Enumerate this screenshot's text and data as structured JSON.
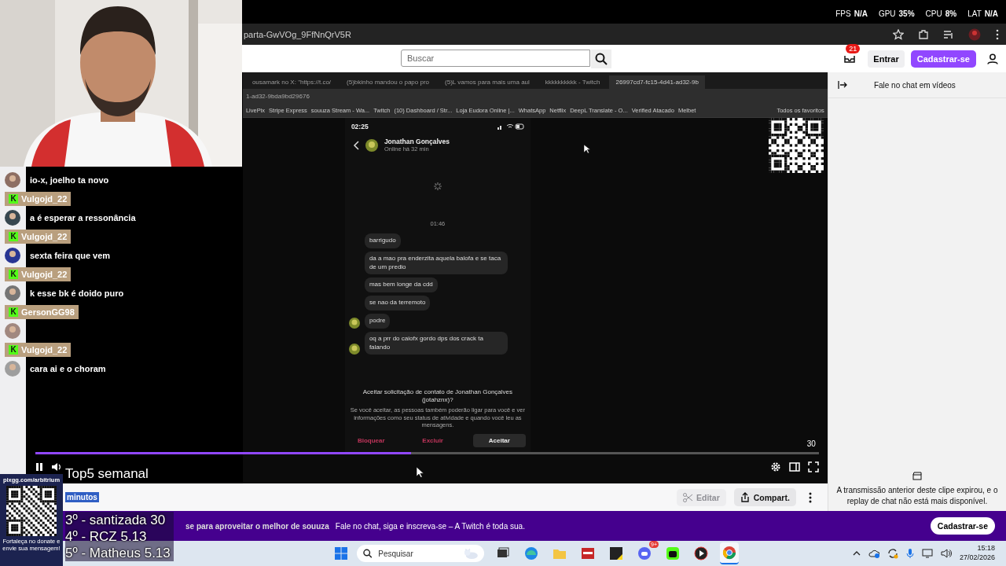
{
  "stats": [
    {
      "label": "FPS",
      "value": "N/A"
    },
    {
      "label": "GPU",
      "value": "35%"
    },
    {
      "label": "CPU",
      "value": "8%"
    },
    {
      "label": "LAT",
      "value": "N/A"
    }
  ],
  "browser": {
    "url": "parta-GwVOg_9FfNnQrV5R"
  },
  "header": {
    "search": {
      "placeholder": "Buscar"
    },
    "notifications": "21",
    "login": "Entrar",
    "signup": "Cadastrar-se"
  },
  "video": {
    "inner_browser": {
      "tabs": [
        {
          "title": "ousamark no X: \"https://t.co/",
          "selected": false
        },
        {
          "title": "(5)bkinho mandou o papo pro",
          "selected": false
        },
        {
          "title": "(5)L vamos para mais uma aul",
          "selected": false
        },
        {
          "title": "kkkkkkkkkk - Twitch",
          "selected": false
        },
        {
          "title": "26997cd7-fc15-4d41-ad32-9b",
          "selected": true
        }
      ],
      "url": "1-ad32-9bda9bd29676",
      "bookmarks": [
        "LivePix",
        "Stripe Express",
        "souuza Stream - Wa...",
        "Twitch",
        "(10) Dashboard / Str...",
        "Loja Eudora Online |...",
        "WhatsApp",
        "Netflix",
        "DeepL Translate - O...",
        "Verified Atacado",
        "Melbet"
      ],
      "all_bookmarks": "Todos os favoritos"
    },
    "phone": {
      "time": "02:25",
      "contact": "Jonathan Gonçalves",
      "status": "Online há 32 min",
      "timestamp": "01:46",
      "messages": [
        {
          "text": "barrigudo",
          "avatar": false
        },
        {
          "text": "da a mao pra enderzita aquela balofa e se taca de um predio",
          "avatar": false
        },
        {
          "text": "mas bem longe da cdd",
          "avatar": false
        },
        {
          "text": "se nao da terremoto",
          "avatar": false
        },
        {
          "text": "podre",
          "avatar": true
        },
        {
          "text": "oq a prr do caiofx gordo dps dos crack ta falando",
          "avatar": true
        }
      ],
      "request_title": "Aceitar solicitação de contato de Jonathan Gonçalves (jotahznx)?",
      "request_body": "Se você aceitar, as pessoas também poderão ligar para você e ver informações como seu status de atividade e quando você leu as mensagens.",
      "buttons": [
        {
          "label": "Bloquear",
          "kind": "danger"
        },
        {
          "label": "Excluir",
          "kind": "danger"
        },
        {
          "label": "Aceitar",
          "kind": "primary"
        }
      ]
    },
    "counter": "30",
    "progress": {
      "level": 0.48
    }
  },
  "actions": {
    "edit": {
      "label": "Editar",
      "disabled": true
    },
    "share": "Compart."
  },
  "chat_panel": {
    "title": "Fale no chat em vídeos",
    "notice": "A transmissão anterior deste clipe expirou, e o replay de chat não está mais disponível."
  },
  "banner": {
    "texts": [
      "se para aproveitar o melhor de souuza",
      "Fale no chat, siga e inscreva-se – A Twitch é toda sua."
    ],
    "button": "Cadastrar-se"
  },
  "taskbar": {
    "search": {
      "placeholder": "Pesquisar"
    },
    "chat_badge": "9+",
    "time": "15:18",
    "date": "27/02/2026"
  },
  "stream_overlay": {
    "chat": [
      {
        "kind": "message",
        "text": "io-x, joelho ta novo"
      },
      {
        "kind": "user",
        "badge": "K",
        "name": "Vulgojd_22"
      },
      {
        "kind": "message",
        "text": "a é esperar a ressonância"
      },
      {
        "kind": "user",
        "badge": "K",
        "name": "Vulgojd_22"
      },
      {
        "kind": "message",
        "text": "sexta feira que vem"
      },
      {
        "kind": "user",
        "badge": "K",
        "name": "Vulgojd_22"
      },
      {
        "kind": "message",
        "text": "k esse bk é doido puro"
      },
      {
        "kind": "user",
        "badge": "K",
        "name": "GersonGG98"
      },
      {
        "kind": "message"
      },
      {
        "kind": "user",
        "badge": "K",
        "name": "Vulgojd_22"
      },
      {
        "kind": "message",
        "text": "cara ai e o choram"
      }
    ],
    "top5": {
      "title": "Top5 semanal",
      "tag": "minutos",
      "entries": [
        "3º - santizada 30",
        "4º - RCZ 5.13",
        "5º - Matheus 5.13"
      ]
    },
    "donate": {
      "url": "pixgg.com/arbitrium",
      "caption": "Fortaleça no donate e envie sua mensagem!"
    }
  }
}
